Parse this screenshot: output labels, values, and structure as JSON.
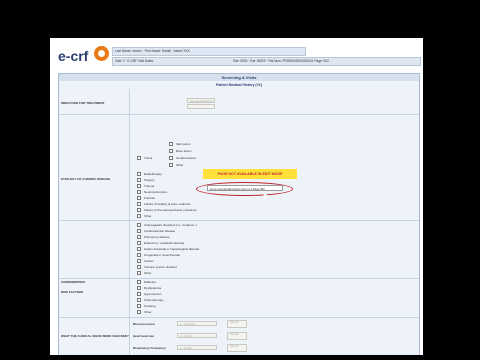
{
  "header": {
    "logo_text": "e-crf",
    "info_line1": "Last Name: xxxxxx · First Name: Daniel · Asset: XXX",
    "info_line2_left": "Visit: 2 · E-CRF Visit Dates",
    "info_line2_right": "Site: 0000 · Pat: 00000 · Pat Num: FR000002000020201 Page: 002"
  },
  "section": {
    "title": "Screening & Visits",
    "subtitle": "Patient Medical History (V1)"
  },
  "rows": {
    "indication": {
      "label": "INDICATION FOR TREATMENT",
      "value": "Sexual dysfunction"
    },
    "etiology": {
      "label": "ETIOLOGY OF CHRONIC DISEASE",
      "tumor_label": "Tumor",
      "tumor_sub": [
        "Skin lesion",
        "Bone lesion",
        "Cerebral lesion",
        "Other"
      ],
      "items": [
        "Radiotherapy",
        "Surgery",
        "Trauma",
        "Neurodysfunction",
        "Fracture",
        "Failure of healing at bone malunion",
        "Failure of the osteosynthesis procedure",
        "Other"
      ]
    },
    "comorbidities": {
      "label": "COMORBIDITIES",
      "items": [
        "Anticoagulant disorders (i.e. Cerebral...)",
        "Cardiovascular disease",
        "Pulmonary disease",
        "Endocrine / metabolic disorder",
        "Gastro-intestinal or hepatological disorder",
        "Urogenital or renal disorder",
        "Cancer",
        "Immune system disorder",
        "Other"
      ],
      "notice": "PAGE NOT AVAILABLE IN EDIT MODE",
      "inset": "Zone encodée/Encoded zone to a Page 002"
    },
    "risk": {
      "label": "RISK FACTORS",
      "items": [
        "Diabetes",
        "Dyslipidemia",
        "Hypertension",
        "Chemotherapy",
        "Smoking",
        "Other"
      ]
    },
    "signs": {
      "label": "WHAT THE CLINICAL SIGNS WERE CHECKED?",
      "vitals": [
        {
          "label": "Blood pressure",
          "value": "2 / 3 systolic",
          "btn": "Normal"
        },
        {
          "label": "Heart beat rate",
          "value": "2 / 3 bpm",
          "btn": "Normal"
        },
        {
          "label": "Respiratory Frequency",
          "value": "2 / 3 /min",
          "btn": "Normal"
        }
      ]
    }
  }
}
